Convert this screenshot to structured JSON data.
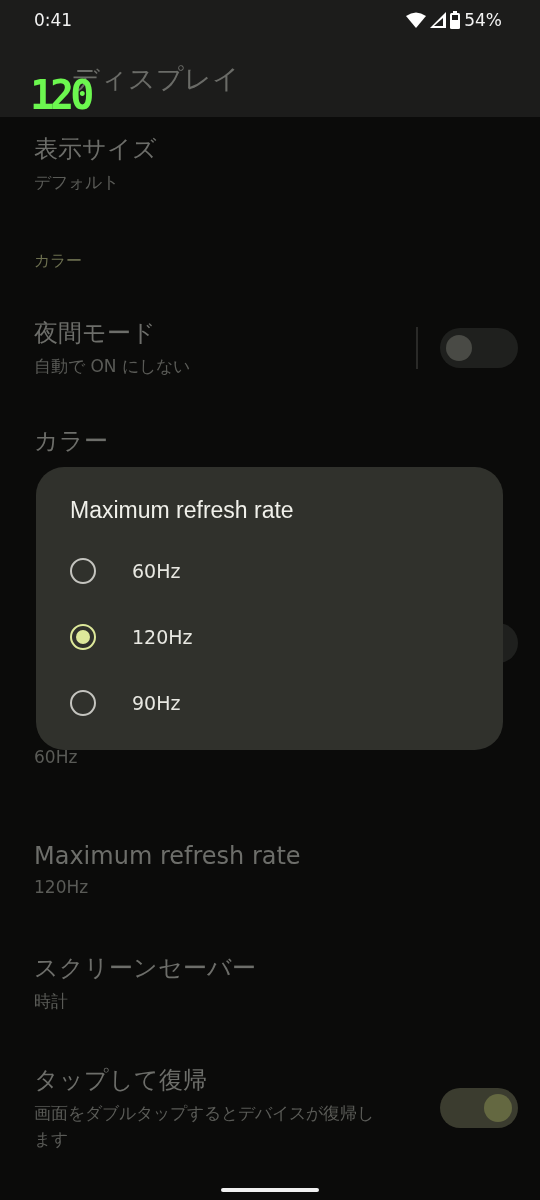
{
  "status_bar": {
    "time": "0:41",
    "battery": "54%"
  },
  "refresh_overlay": "120",
  "app_bar": {
    "title": "ディスプレイ"
  },
  "items": [
    {
      "kind": "row",
      "title": "表示サイズ",
      "subtitle": "デフォルト"
    },
    {
      "kind": "section",
      "title": "カラー"
    },
    {
      "kind": "split-toggle",
      "title": "夜間モード",
      "subtitle": "自動で ON にしない",
      "on": false
    },
    {
      "kind": "row",
      "title": "カラー"
    },
    {
      "kind": "section"
    },
    {
      "kind": "toggle",
      "on": false
    },
    {
      "kind": "row",
      "subtitle": "60Hz"
    },
    {
      "kind": "row",
      "title": "Maximum refresh rate",
      "subtitle": "120Hz"
    },
    {
      "kind": "row",
      "title": "スクリーンセーバー",
      "subtitle": "時計"
    },
    {
      "kind": "toggle",
      "title": "タップして復帰",
      "subtitle": "画面をダブルタップするとデバイスが復帰します",
      "on": true
    }
  ],
  "dialog": {
    "title": "Maximum refresh rate",
    "options": [
      {
        "label": "60Hz",
        "selected": false
      },
      {
        "label": "120Hz",
        "selected": true
      },
      {
        "label": "90Hz",
        "selected": false
      }
    ]
  }
}
